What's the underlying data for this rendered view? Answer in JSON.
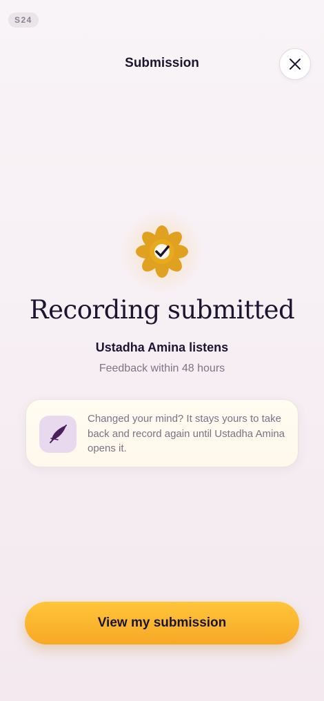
{
  "screen_badge": "S24",
  "header": {
    "title": "Submission",
    "close_icon": "close-icon"
  },
  "confirmation": {
    "icon": "flower-check-icon",
    "headline": "Recording submitted",
    "teacher_line": "Ustadha Amina listens",
    "feedback_line": "Feedback within 48 hours"
  },
  "info_card": {
    "icon": "quill-icon",
    "text": "Changed your mind? It stays yours to take back and record again until Ustadha Amina opens it."
  },
  "primary_action": {
    "label": "View my submission"
  },
  "colors": {
    "accent": "#f7a826",
    "flower": "#e0a020",
    "quill": "#4a1f5c",
    "card_icon_bg": "#e9d9ee"
  }
}
